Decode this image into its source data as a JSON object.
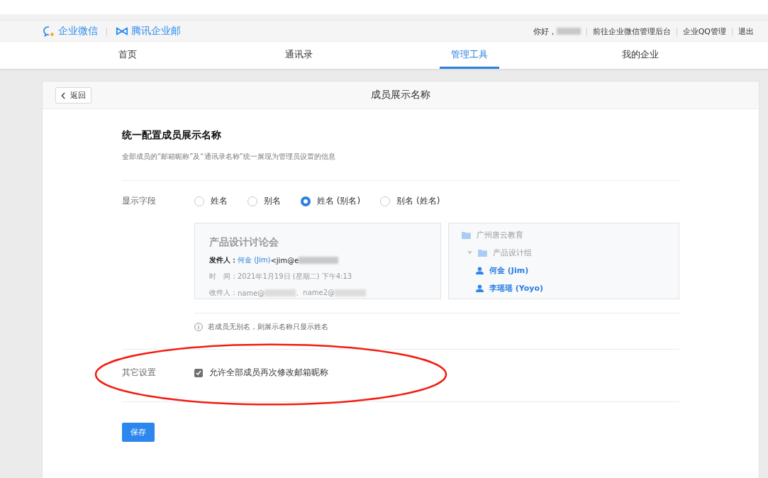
{
  "header": {
    "logos": [
      {
        "kind": "wework",
        "label": "企业微信"
      },
      {
        "kind": "exmail",
        "label": "腾讯企业邮"
      }
    ],
    "greeting": "你好，",
    "links": [
      "前往企业微信管理后台",
      "企业QQ管理",
      "退出"
    ]
  },
  "nav": [
    {
      "label": "首页",
      "selected": false
    },
    {
      "label": "通讯录",
      "selected": false
    },
    {
      "label": "管理工具",
      "selected": true
    },
    {
      "label": "我的企业",
      "selected": false
    }
  ],
  "page": {
    "back": "返回",
    "title": "成员展示名称"
  },
  "section": {
    "heading": "统一配置成员展示名称",
    "description": "全部成员的“邮箱昵称”及“通讯录名称”统一展现为管理员设置的信息"
  },
  "display_field": {
    "label": "显示字段",
    "options": [
      {
        "label": "姓名",
        "selected": false
      },
      {
        "label": "别名",
        "selected": false
      },
      {
        "label": "姓名 (别名)",
        "selected": true
      },
      {
        "label": "别名 (姓名)",
        "selected": false
      }
    ]
  },
  "mail_preview": {
    "subject": "产品设计讨论会",
    "sender_label": "发件人：",
    "sender_name": "何金 (Jim)",
    "sender_email": "<jim@e",
    "time": "时　间：2021年1月19日 (星期二) 下午4:13",
    "recipients_label": "收件人：",
    "recipients": [
      "name@",
      "、name2@"
    ]
  },
  "contacts_preview": [
    {
      "kind": "folder",
      "label": "广州唐云教育",
      "children": [
        {
          "kind": "folder",
          "label": "产品设计组",
          "expanded": true,
          "children": [
            {
              "kind": "person",
              "label": "何金 (Jim)"
            },
            {
              "kind": "person",
              "label": "李瑶瑶 (Yoyo)"
            }
          ]
        }
      ]
    }
  ],
  "note": "若成员无别名，则展示名称只显示姓名",
  "other_settings": {
    "label": "其它设置",
    "option": {
      "label": "允许全部成员再次修改邮箱昵称",
      "checked": true
    }
  },
  "annotation": {
    "kind": "ellipse"
  },
  "save": "保存"
}
